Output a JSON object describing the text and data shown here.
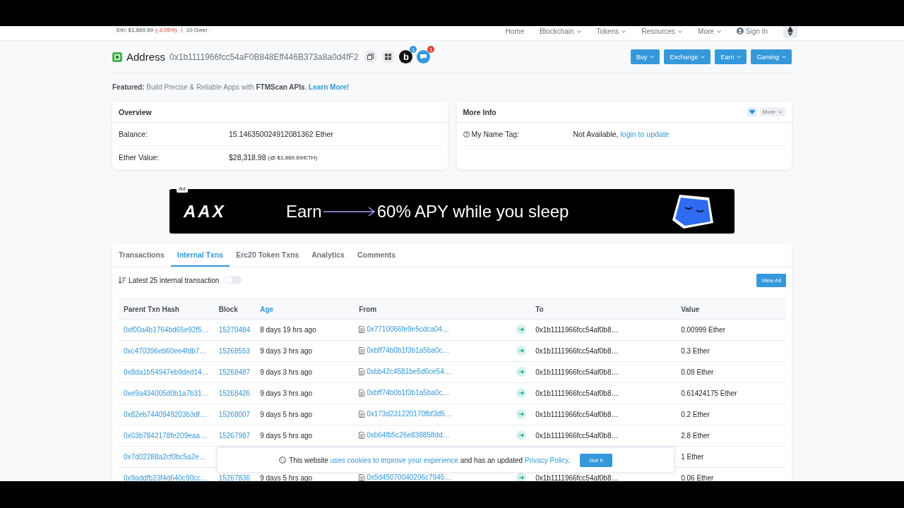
{
  "topbar": {
    "eth_price": "Eth: $1,869.69",
    "eth_change": "(-3.05%)",
    "gas": "10 Gwei",
    "nav": [
      {
        "label": "Home",
        "dropdown": false
      },
      {
        "label": "Blockchain",
        "dropdown": true
      },
      {
        "label": "Tokens",
        "dropdown": true
      },
      {
        "label": "Resources",
        "dropdown": true
      },
      {
        "label": "More",
        "dropdown": true
      }
    ],
    "sign_in": "Sign In"
  },
  "address": {
    "title": "Address",
    "hash": "0x1b1111966fcc54aF0B848Eff446B373a8a0d4fF2",
    "logo_letter": "b",
    "badges": [
      "1",
      "1"
    ]
  },
  "action_buttons": [
    "Buy",
    "Exchange",
    "Earn",
    "Gaming"
  ],
  "featured": {
    "text": "**Featured:** Build Precise & Reliable Apps with **FTMScan APIs**.",
    "link": "Learn More!"
  },
  "overview": {
    "title": "Overview",
    "rows": [
      {
        "label": "Balance:",
        "value": "15.146350024912081362 Ether"
      },
      {
        "label": "Ether Value:",
        "value": "$28,318.98",
        "note": "(@ $1,869.69/ETH)"
      }
    ]
  },
  "more_info": {
    "title": "More Info",
    "more": "More",
    "name_tag_label": "My Name Tag:",
    "name_tag_value": "Not Available,",
    "name_tag_link": "login to update"
  },
  "ad": {
    "badge": "Ad",
    "logo": "AAX",
    "left": "Earn",
    "right": "60% APY while you sleep"
  },
  "tabs": [
    {
      "label": "Transactions",
      "selected": false
    },
    {
      "label": "Internal Txns",
      "selected": true
    },
    {
      "label": "Erc20 Token Txns",
      "selected": false
    },
    {
      "label": "Analytics",
      "selected": false
    },
    {
      "label": "Comments",
      "selected": false
    }
  ],
  "filter": {
    "label": "Latest 25 internal transaction",
    "on": false,
    "view_all": "View All"
  },
  "table": {
    "columns": [
      {
        "label": "Parent Txn Hash",
        "sortable": false
      },
      {
        "label": "Block",
        "sortable": false
      },
      {
        "label": "Age",
        "sortable": true
      },
      {
        "label": "From",
        "sortable": false
      },
      {
        "label": "To",
        "sortable": false
      },
      {
        "label": "Value",
        "sortable": false
      }
    ],
    "rows": [
      {
        "hash": "0xf00a4b1764bd65e92f5…",
        "block": "15270484",
        "age": "8 days 19 hrs ago",
        "from": "0x7710066fe9e5cdca04…",
        "to": "0x1b1111966fcc54af0b8…",
        "value": "0.00999 Ether"
      },
      {
        "hash": "0xc470396eb60ee4fdb7…",
        "block": "15268553",
        "age": "9 days 3 hrs ago",
        "from": "0xbff74b0b1f3b1a5ba0c…",
        "to": "0x1b1111966fcc54af0b8…",
        "value": "0.3 Ether"
      },
      {
        "hash": "0x8da1b54947eb9ded14…",
        "block": "15268487",
        "age": "9 days 3 hrs ago",
        "from": "0xbb42c4581be5d6ce54…",
        "to": "0x1b1111966fcc54af0b8…",
        "value": "0.09 Ether"
      },
      {
        "hash": "0xe9a434005d0b1a7b31…",
        "block": "15268426",
        "age": "9 days 3 hrs ago",
        "from": "0xbff74b0b1f3b1a5ba0c…",
        "to": "0x1b1111966fcc54af0b8…",
        "value": "0.61424175 Ether"
      },
      {
        "hash": "0x82eb7440949203b3df…",
        "block": "15268007",
        "age": "9 days 5 hrs ago",
        "from": "0x173d231220170fbf3d5…",
        "to": "0x1b1111966fcc54af0b8…",
        "value": "0.2 Ether"
      },
      {
        "hash": "0x03b7842178fe209eaa…",
        "block": "15267987",
        "age": "9 days 5 hrs ago",
        "from": "0xb64fb5c26e838858dd…",
        "to": "0x1b1111966fcc54af0b8…",
        "value": "2.8 Ether"
      },
      {
        "hash": "0x7d02288a2cf0bc5a2e…",
        "value": "1 Ether"
      },
      {
        "hash": "0x9addfb23f4d640c90cc…",
        "block": "15267836",
        "age": "9 days 5 hrs ago",
        "from": "0x5d45070040206c7945…",
        "to": "0x1b1111966fcc54af0b8…",
        "value": "0.06 Ether"
      }
    ]
  },
  "cookie": {
    "text_before": "This website",
    "link1": "uses cookies to improve your experience",
    "text_mid": "and has an updated",
    "link2": "Privacy Policy",
    "text_end": ".",
    "button": "Got It"
  }
}
